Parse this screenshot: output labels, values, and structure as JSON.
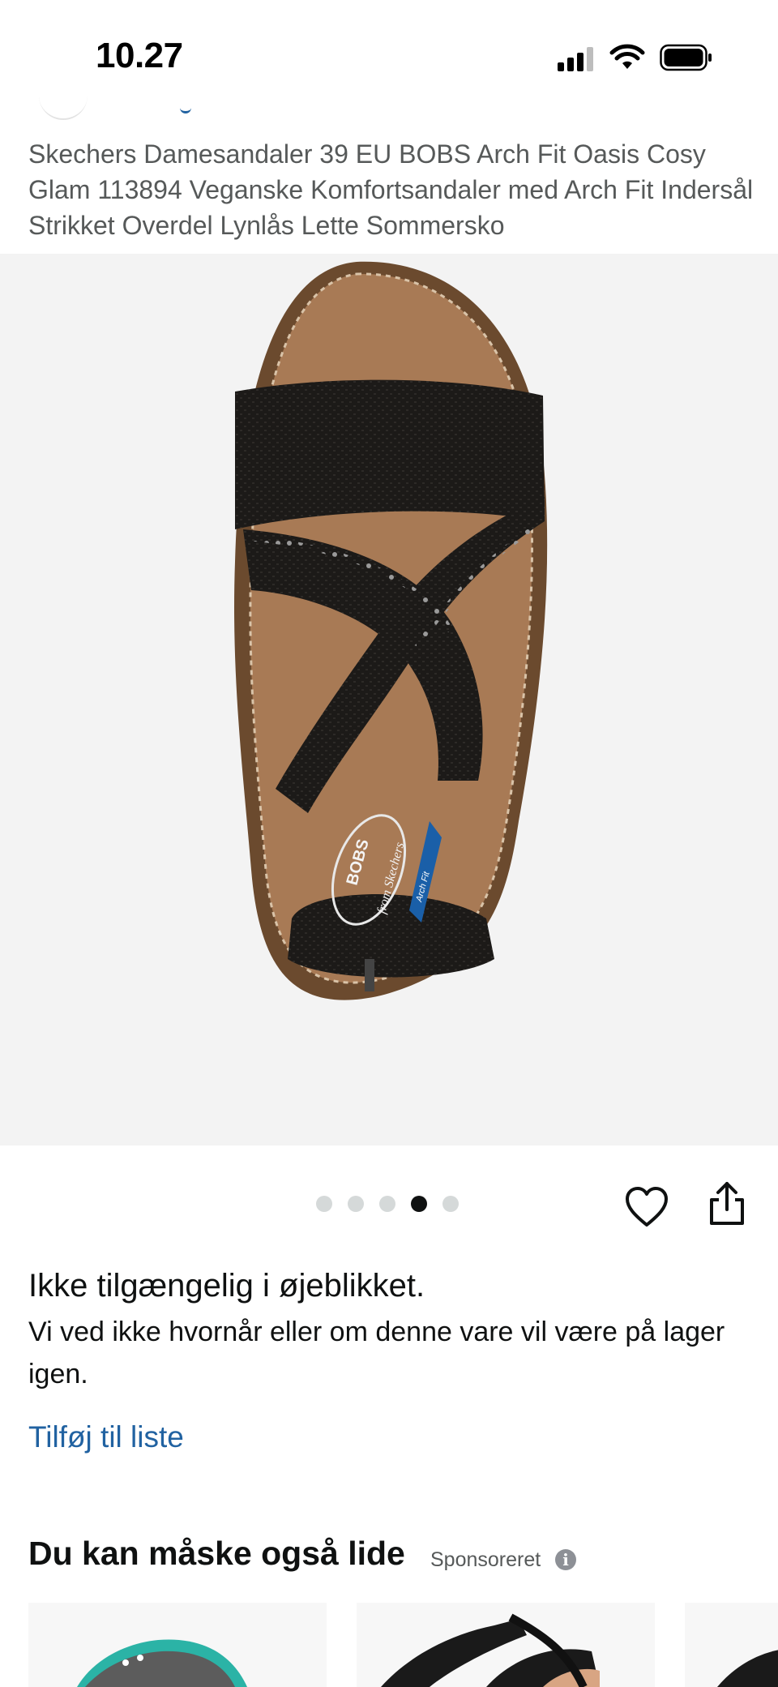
{
  "status_bar": {
    "time": "10.27",
    "signal_icon": "cellular-signal-icon",
    "wifi_icon": "wifi-icon",
    "battery_icon": "battery-icon"
  },
  "product": {
    "title": "Skechers Damesandaler 39 EU BOBS Arch Fit Oasis Cosy Glam 113894 Veganske Komfortsandaler med Arch Fit Indersål Strikket Overdel Lynlås Lette Sommersko",
    "image_count": 5,
    "active_image_index": 3,
    "insole_logo_text": "BOBS",
    "insole_brand_text": "from Skechers",
    "insole_arch_text": "Arch Fit"
  },
  "actions": {
    "favorite_icon": "heart-icon",
    "share_icon": "share-icon"
  },
  "availability": {
    "title": "Ikke tilgængelig i øjeblikket.",
    "description": "Vi ved ikke hvornår eller om denne vare vil være på lager igen."
  },
  "add_to_list": {
    "label": "Tilføj til liste"
  },
  "recommendations": {
    "title": "Du kan måske også lide",
    "sponsored_label": "Sponsoreret",
    "info_icon": "info-icon",
    "info_glyph": "i",
    "item_count_visible": 3
  },
  "colors": {
    "link": "#2162a1",
    "text": "#0f1111",
    "muted": "#565959",
    "image_background": "#f3f3f3"
  }
}
